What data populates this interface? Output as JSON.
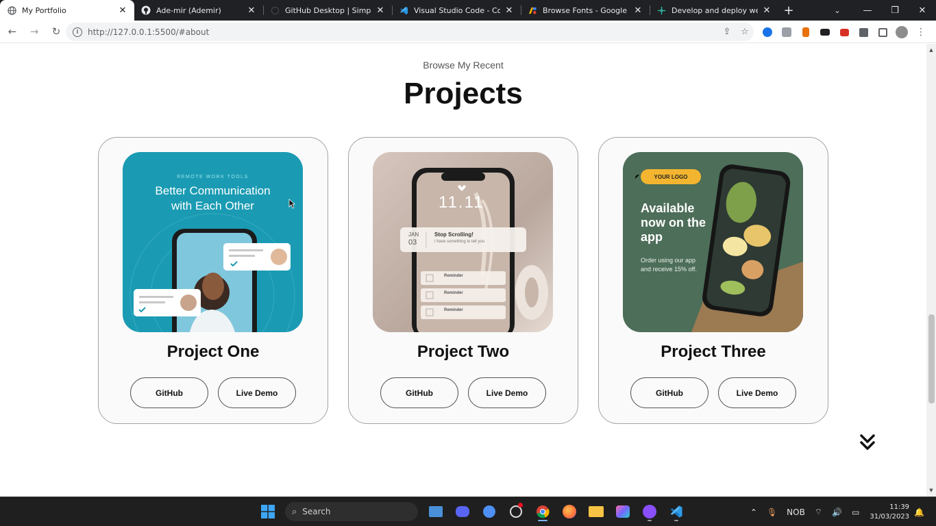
{
  "browser": {
    "tabs": [
      {
        "title": "My Portfolio",
        "icon": "globe-icon",
        "active": true
      },
      {
        "title": "Ade-mir (Ademir)",
        "icon": "github-icon",
        "active": false
      },
      {
        "title": "GitHub Desktop | Simple co",
        "icon": "loading-icon",
        "active": false
      },
      {
        "title": "Visual Studio Code - Code",
        "icon": "vscode-icon",
        "active": false
      },
      {
        "title": "Browse Fonts - Google Fon",
        "icon": "google-fonts-icon",
        "active": false
      },
      {
        "title": "Develop and deploy websit",
        "icon": "netlify-icon",
        "active": false
      }
    ],
    "url": "http://127.0.0.1:5500/#about"
  },
  "section": {
    "subtitle": "Browse My Recent",
    "title": "Projects"
  },
  "projects": [
    {
      "name": "Project One",
      "github_label": "GitHub",
      "demo_label": "Live Demo",
      "thumb_small": "REMOTE WORK TOOLS",
      "thumb_big_1": "Better Communication",
      "thumb_big_2": "with Each Other"
    },
    {
      "name": "Project Two",
      "github_label": "GitHub",
      "demo_label": "Live Demo",
      "thumb_clock": "11.11",
      "thumb_notice_title": "Stop Scrolling!",
      "thumb_notice_body": "I have something to tell you",
      "thumb_date_month": "JAN",
      "thumb_date_day": "03",
      "thumb_reminder": "Reminder"
    },
    {
      "name": "Project Three",
      "github_label": "GitHub",
      "demo_label": "Live Demo",
      "thumb_logo": "YOUR LOGO",
      "thumb_headline": "Available now on the app",
      "thumb_order": "Order using our app and receive 15% off."
    }
  ],
  "taskbar": {
    "search_label": "Search",
    "lang": "NOB",
    "time": "11:39",
    "date": "31/03/2023"
  }
}
